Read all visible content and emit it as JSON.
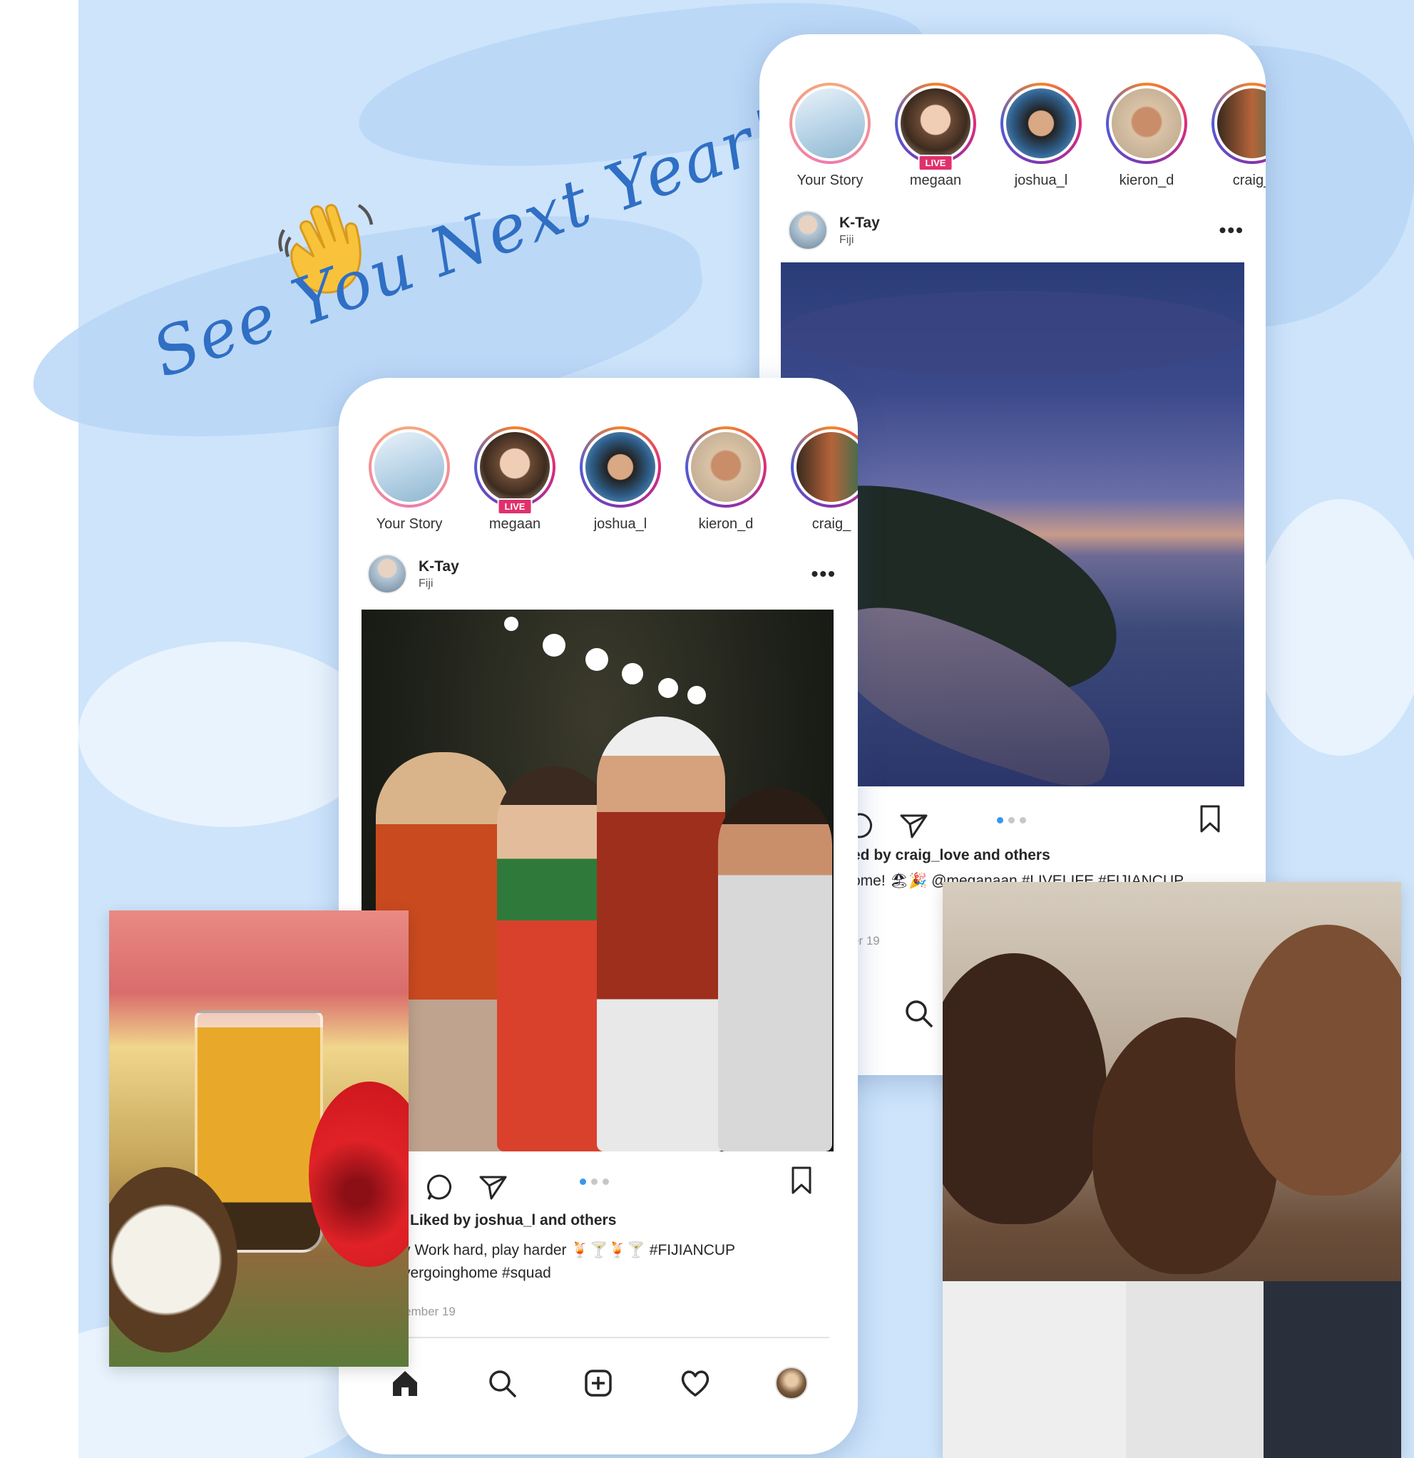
{
  "headline": "See You Next Year!",
  "colors": {
    "accent": "#3897f0",
    "live": "#e1306c",
    "headline": "#2f6fc4",
    "background": "#cde4fb"
  },
  "stories": [
    {
      "name": "Your Story"
    },
    {
      "name": "megaan",
      "badge": "LIVE"
    },
    {
      "name": "joshua_l"
    },
    {
      "name": "kieron_d"
    },
    {
      "name": "craig_"
    }
  ],
  "front_post": {
    "user": "K-Tay",
    "location": "Fiji",
    "likes": "Liked by joshua_l and others",
    "caption_line1": "y Work hard, play harder 🍹🍸🍹🍸  #FIJIANCUP",
    "caption_line2": "vergoinghome #squad",
    "date": "ember 19"
  },
  "back_post": {
    "user": "K-Tay",
    "location": "Fiji",
    "likes": "ed by craig_love and others",
    "caption": "ome! 🏖🎉 @meganaan #LIVELIFE #FIJIANCUP",
    "date": "er 19"
  },
  "icons": [
    "waving-hand-icon",
    "more-icon",
    "comment-icon",
    "share-icon",
    "bookmark-icon",
    "home-icon",
    "search-icon",
    "add-post-icon",
    "heart-icon",
    "profile-icon"
  ]
}
